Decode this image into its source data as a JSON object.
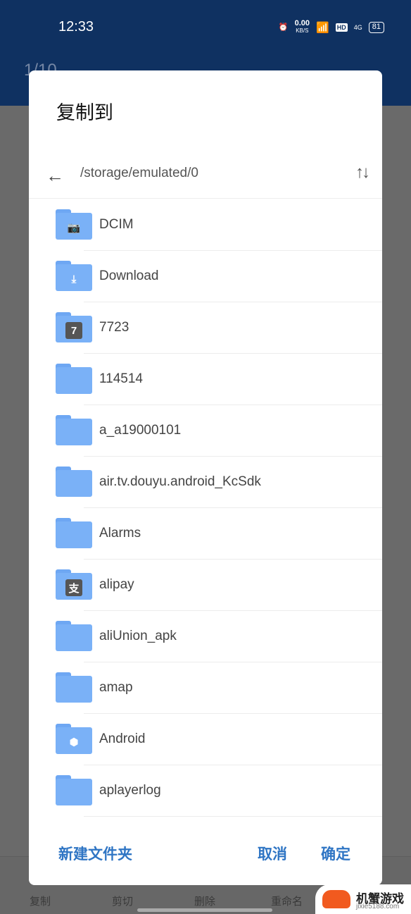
{
  "status": {
    "time": "12:33",
    "net_speed": "0.00",
    "net_unit": "KB/S",
    "hd": "HD",
    "signal": "4G",
    "battery": "81"
  },
  "background": {
    "counter": "1/10",
    "bottom_actions": [
      "复制",
      "剪切",
      "删除",
      "重命名"
    ]
  },
  "dialog": {
    "title": "复制到",
    "path": "/storage/emulated/0",
    "items": [
      {
        "name": "DCIM",
        "icon": "camera-folder-icon"
      },
      {
        "name": "Download",
        "icon": "download-folder-icon"
      },
      {
        "name": "7723",
        "icon": "app-7723-folder-icon"
      },
      {
        "name": "114514",
        "icon": "folder-icon"
      },
      {
        "name": "a_a19000101",
        "icon": "folder-icon"
      },
      {
        "name": "air.tv.douyu.android_KcSdk",
        "icon": "folder-icon"
      },
      {
        "name": "Alarms",
        "icon": "folder-icon"
      },
      {
        "name": "alipay",
        "icon": "alipay-folder-icon"
      },
      {
        "name": "aliUnion_apk",
        "icon": "folder-icon"
      },
      {
        "name": "amap",
        "icon": "folder-icon"
      },
      {
        "name": "Android",
        "icon": "android-settings-folder-icon"
      },
      {
        "name": "aplayerlog",
        "icon": "folder-icon"
      }
    ],
    "new_folder": "新建文件夹",
    "cancel": "取消",
    "confirm": "确定"
  },
  "watermark": {
    "text": "机蟹游戏",
    "url": "jixie5188.com"
  },
  "colors": {
    "accent": "#2f75c4",
    "folder": "#7ab1f7",
    "topbar": "#0f3161"
  }
}
